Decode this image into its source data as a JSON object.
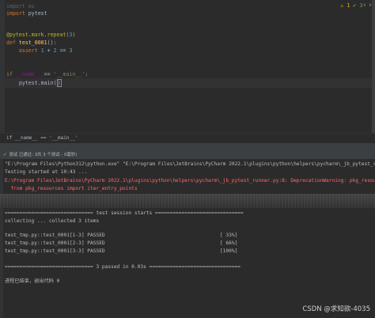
{
  "editor": {
    "lines": {
      "l1_kw": "import",
      "l1_rest": " os",
      "l2_kw": "import",
      "l2_rest": " pytest",
      "l3_dec": "@pytest.mark.repeat(",
      "l3_num": "3",
      "l3_end": ")",
      "l4_kw": "def",
      "l4_fn": " test_0001",
      "l4_end": "():",
      "l5_indent": "    ",
      "l5_kw": "assert",
      "l5_a": " ",
      "l5_n1": "1",
      "l5_op": " + ",
      "l5_n2": "2",
      "l5_eq": " == ",
      "l5_n3": "3",
      "l6_kw": "if",
      "l6_a": " ",
      "l6_dunder": "__name__",
      "l6_eq": " == ",
      "l6_str": "'__main__'",
      "l6_end": ":",
      "l7_indent": "    ",
      "l7_text": "pytest.main(",
      "l7_paren": ")"
    },
    "indicators": {
      "warn": "⚠ 1",
      "ok": "✔ 3",
      "arrows": "∧ ∨"
    }
  },
  "breadcrumb": "if __name__ == '__main__'",
  "toolbar": {
    "text": "测试 已通过: 3共 3 个测试 - 0毫秒)"
  },
  "output": {
    "cmd": "\"E:\\Program Files\\Python312\\python.exe\" \"E:\\Program Files\\JetBrains\\PyCharm 2022.1\\plugins\\python\\helpers\\pycharm\\_jb_pytest_runner",
    "started": "Testing started at 10:43 ...",
    "err1": "E:\\Program Files\\JetBrains\\PyCharm 2022.1\\plugins\\python\\helpers\\pycharm\\_jb_pytest_runner.py:8: DeprecationWarning: pkg_resources",
    "err2": "  from pkg_resources import iter_entry_points",
    "session": "============================== test session starts ==============================",
    "collecting": "collecting ... collected 3 items",
    "r1": "test_tmp.py::test_0001[1-3] PASSED                                       [ 33%]",
    "r2": "test_tmp.py::test_0001[2-3] PASSED                                       [ 66%]",
    "r3": "test_tmp.py::test_0001[3-3] PASSED                                       [100%]",
    "summary": "============================== 3 passed in 0.03s ===============================",
    "finished": "进程已结束，退出代码 0"
  },
  "watermark": "CSDN @求知欲-4035"
}
